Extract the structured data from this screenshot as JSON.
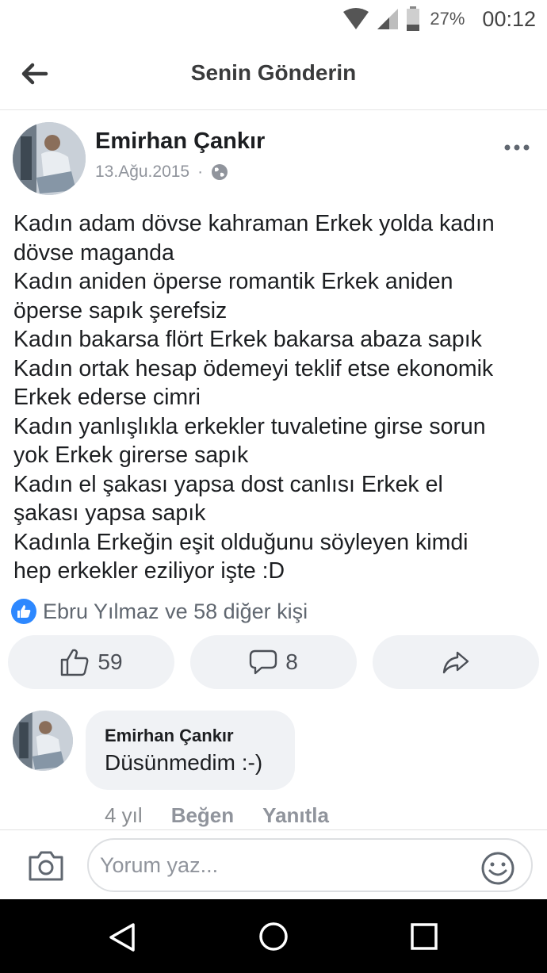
{
  "status_bar": {
    "battery_percent": "27%",
    "time": "00:12",
    "icons": [
      "wifi-icon",
      "signal-icon",
      "battery-icon"
    ]
  },
  "header": {
    "title": "Senin Gönderin",
    "back_icon": "arrow-left-icon"
  },
  "post": {
    "author": "Emirhan Çankır",
    "date": "13.Ağu.2015",
    "separator": "·",
    "privacy_icon": "globe-icon",
    "more_icon": "more-horizontal-icon",
    "lines": [
      "Kadın adam dövse kahraman Erkek yolda kadın",
      "dövse maganda",
      "Kadın aniden öperse romantik Erkek aniden",
      "öperse sapık şerefsiz",
      "Kadın bakarsa flört Erkek bakarsa abaza sapık",
      "Kadın ortak hesap ödemeyi teklif etse ekonomik",
      "Erkek ederse cimri",
      "Kadın yanlışlıkla erkekler tuvaletine girse sorun",
      "yok Erkek girerse sapık",
      "Kadın el şakası yapsa dost canlısı Erkek el",
      "şakası yapsa sapık",
      "Kadınla Erkeğin eşit olduğunu söyleyen kimdi",
      "hep erkekler eziliyor işte :D"
    ],
    "likes_summary": "Ebru Yılmaz ve 58 diğer kişi",
    "like_count": "59",
    "comment_count": "8"
  },
  "comment": {
    "author": "Emirhan Çankır",
    "text": "Düsünmedim :-)",
    "time": "4 yıl",
    "like_label": "Beğen",
    "reply_label": "Yanıtla"
  },
  "composer": {
    "placeholder": "Yorum yaz..."
  },
  "colors": {
    "accent": "#2d88ff",
    "bubble": "#f0f2f5",
    "muted": "#90949c",
    "text": "#1c1e21"
  }
}
